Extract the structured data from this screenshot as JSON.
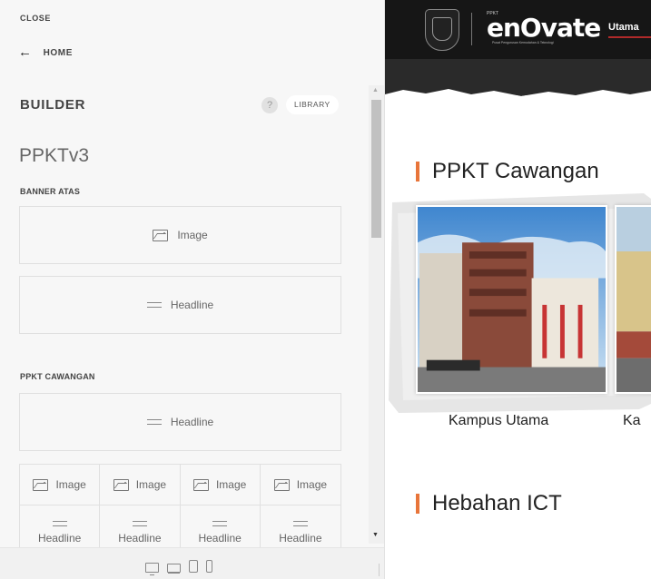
{
  "sidebar": {
    "close_label": "CLOSE",
    "home_label": "HOME",
    "builder_title": "BUILDER",
    "help_label": "?",
    "library_label": "LIBRARY",
    "page_name": "PPKTv3",
    "sections": [
      {
        "label": "BANNER ATAS",
        "blocks": [
          {
            "type": "image-icon",
            "label": "Image"
          },
          {
            "type": "headline-icon",
            "label": "Headline"
          }
        ]
      },
      {
        "label": "PPKT CAWANGAN",
        "blocks": [
          {
            "type": "headline-icon",
            "label": "Headline"
          }
        ],
        "grid": {
          "row1": [
            "Image",
            "Image",
            "Image",
            "Image"
          ],
          "row2": [
            "Headline",
            "Headline",
            "Headline",
            "Headline"
          ]
        }
      }
    ],
    "device_icons": [
      "desktop-icon",
      "laptop-icon",
      "tablet-icon",
      "phone-icon"
    ]
  },
  "preview": {
    "logo_text": "enOvate",
    "logo_tiny": "PPKT",
    "logo_sub": "Pusat Pengurusan Kemudahan & Teknologi",
    "nav_item": "Utama",
    "section1_title": "PPKT Cawangan",
    "captions": [
      "Kampus Utama",
      "Ka"
    ],
    "section2_title": "Hebahan ICT"
  },
  "colors": {
    "accent": "#e8753a",
    "topbar": "#161616",
    "nav_underline": "#b02a2a"
  }
}
